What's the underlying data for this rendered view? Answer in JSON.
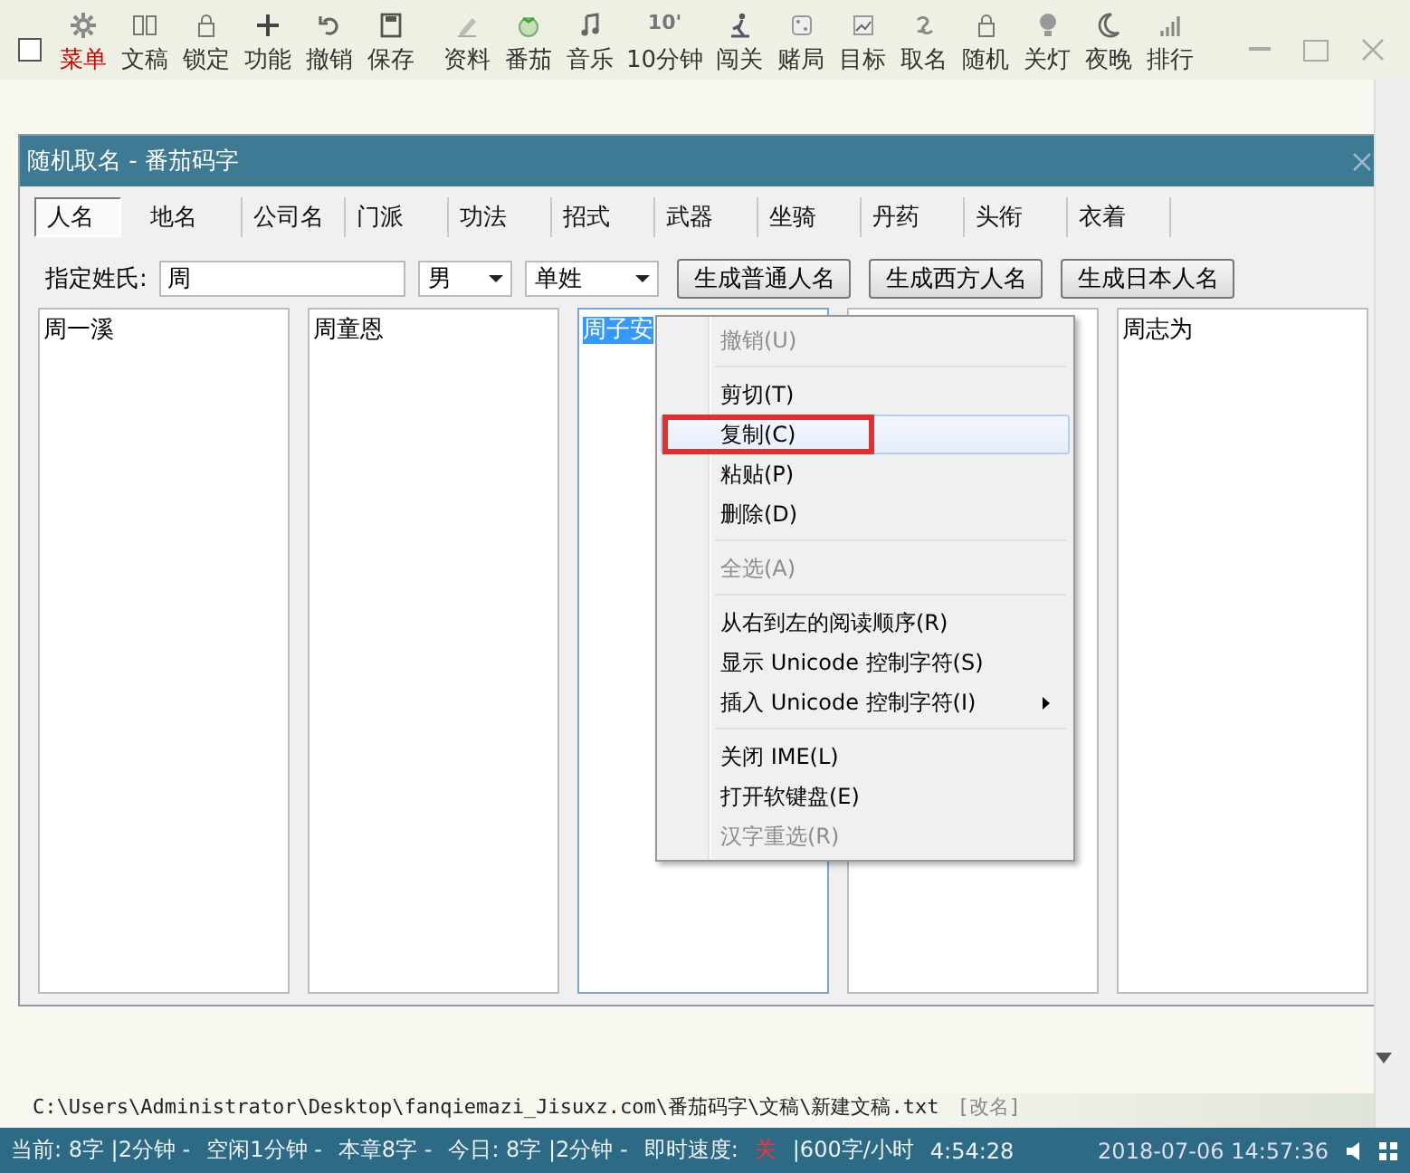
{
  "toolbar": {
    "checkbox": {
      "checked": false
    },
    "items": [
      {
        "label": "菜单",
        "kind": "gear",
        "selected": true
      },
      {
        "label": "文稿",
        "kind": "book",
        "selected": false
      },
      {
        "label": "锁定",
        "kind": "lock",
        "selected": false
      },
      {
        "label": "功能",
        "kind": "plus",
        "selected": false
      },
      {
        "label": "撤销",
        "kind": "undo",
        "selected": false
      },
      {
        "label": "保存",
        "kind": "save",
        "selected": false
      },
      {
        "label": "资料",
        "kind": "pencil",
        "selected": false
      },
      {
        "label": "番茄",
        "kind": "tomato",
        "selected": false
      },
      {
        "label": "音乐",
        "kind": "note",
        "selected": false
      },
      {
        "label": "10分钟",
        "kind": "text",
        "icon_text": "10'",
        "selected": false
      },
      {
        "label": "闯关",
        "kind": "figure",
        "selected": false
      },
      {
        "label": "赌局",
        "kind": "dice",
        "selected": false
      },
      {
        "label": "目标",
        "kind": "chart",
        "selected": false
      },
      {
        "label": "取名",
        "kind": "swirl",
        "selected": false
      },
      {
        "label": "随机",
        "kind": "lock",
        "selected": false
      },
      {
        "label": "关灯",
        "kind": "bulb",
        "selected": false
      },
      {
        "label": "夜晚",
        "kind": "moon",
        "selected": false
      },
      {
        "label": "排行",
        "kind": "bars",
        "selected": false
      }
    ]
  },
  "dialog": {
    "title": "随机取名 - 番茄码字",
    "tabs": [
      {
        "label": "人名",
        "selected": true
      },
      {
        "label": "地名",
        "selected": false
      },
      {
        "label": "公司名",
        "selected": false
      },
      {
        "label": "门派",
        "selected": false
      },
      {
        "label": "功法",
        "selected": false
      },
      {
        "label": "招式",
        "selected": false
      },
      {
        "label": "武器",
        "selected": false
      },
      {
        "label": "坐骑",
        "selected": false
      },
      {
        "label": "丹药",
        "selected": false
      },
      {
        "label": "头衔",
        "selected": false
      },
      {
        "label": "衣着",
        "selected": false
      }
    ],
    "surname_label": "指定姓氏:",
    "surname": "周",
    "gender": "男",
    "surname_type": "单姓",
    "buttons": [
      "生成普通人名",
      "生成西方人名",
      "生成日本人名"
    ],
    "name_lists": [
      {
        "focused": false,
        "names": [
          {
            "text": "周一溪",
            "selected": false
          }
        ]
      },
      {
        "focused": false,
        "names": [
          {
            "text": "周童恩",
            "selected": false
          }
        ]
      },
      {
        "focused": true,
        "names": [
          {
            "text": "周子安",
            "selected": true
          }
        ]
      },
      {
        "focused": false
      },
      {
        "focused": false,
        "names": [
          {
            "text": "周志为",
            "selected": false
          }
        ]
      }
    ]
  },
  "context_menu": {
    "items": [
      {
        "kind": "item",
        "label": "撤销(U)",
        "disabled": true,
        "highlighted": false,
        "submenu": false
      },
      {
        "kind": "separator"
      },
      {
        "kind": "item",
        "label": "剪切(T)",
        "disabled": false,
        "highlighted": false,
        "submenu": false
      },
      {
        "kind": "item",
        "label": "复制(C)",
        "disabled": false,
        "highlighted": true,
        "submenu": false
      },
      {
        "kind": "item",
        "label": "粘贴(P)",
        "disabled": false,
        "highlighted": false,
        "submenu": false
      },
      {
        "kind": "item",
        "label": "删除(D)",
        "disabled": false,
        "highlighted": false,
        "submenu": false
      },
      {
        "kind": "separator"
      },
      {
        "kind": "item",
        "label": "全选(A)",
        "disabled": true,
        "highlighted": false,
        "submenu": false
      },
      {
        "kind": "separator"
      },
      {
        "kind": "item",
        "label": "从右到左的阅读顺序(R)",
        "disabled": false,
        "highlighted": false,
        "submenu": false
      },
      {
        "kind": "item",
        "label": "显示 Unicode 控制字符(S)",
        "disabled": false,
        "highlighted": false,
        "submenu": false
      },
      {
        "kind": "item",
        "label": "插入 Unicode 控制字符(I)",
        "disabled": false,
        "highlighted": false,
        "submenu": true
      },
      {
        "kind": "separator"
      },
      {
        "kind": "item",
        "label": "关闭 IME(L)",
        "disabled": false,
        "highlighted": false,
        "submenu": false
      },
      {
        "kind": "item",
        "label": "打开软键盘(E)",
        "disabled": false,
        "highlighted": false,
        "submenu": false
      },
      {
        "kind": "item",
        "label": "汉字重选(R)",
        "disabled": true,
        "highlighted": false,
        "submenu": false
      }
    ]
  },
  "file_path": "C:\\Users\\Administrator\\Desktop\\fanqiemazi_Jisuxz.com\\番茄码字\\文稿\\新建文稿.txt",
  "rename_link": "[改名]",
  "status_bar": {
    "segments": [
      {
        "text": "当前: 8字 |2分钟 -",
        "alert": false
      },
      {
        "text": "空闲1分钟 -",
        "alert": false
      },
      {
        "text": "本章8字 -",
        "alert": false
      },
      {
        "text": "今日: 8字 |2分钟 -",
        "alert": false
      },
      {
        "text": "即时速度:",
        "alert": false
      },
      {
        "text": "关",
        "alert": true
      },
      {
        "text": "|600字/小时",
        "alert": false
      },
      {
        "text": "4:54:28",
        "alert": false
      }
    ],
    "datetime": "2018-07-06 14:57:36"
  }
}
